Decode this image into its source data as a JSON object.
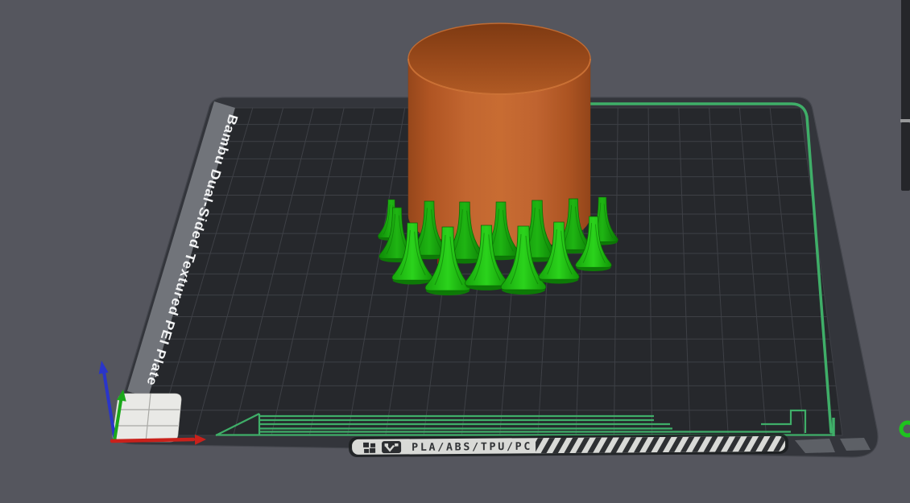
{
  "viewport": {
    "description": "3D slicer build-plate viewport",
    "background_color": "#55565E"
  },
  "plate": {
    "side_label": "Bambu Dual-Sided Textured PEI Plate",
    "front_label": "PLA/ABS/TPU/PC",
    "surface_color": "#26282C",
    "frame_color": "#33353B",
    "grid_color": "#3E4046",
    "outline_color": "#3FAE68"
  },
  "model": {
    "shape": "cylinder",
    "color": "#BE6128",
    "support_color": "#22C112"
  },
  "axes": {
    "x_color": "#C9211B",
    "y_color": "#1BA81B",
    "z_color": "#2A35C9"
  },
  "icons": {
    "plate_squares": "bambu-squares-icon",
    "plate_badge": "qr-badge-icon"
  }
}
